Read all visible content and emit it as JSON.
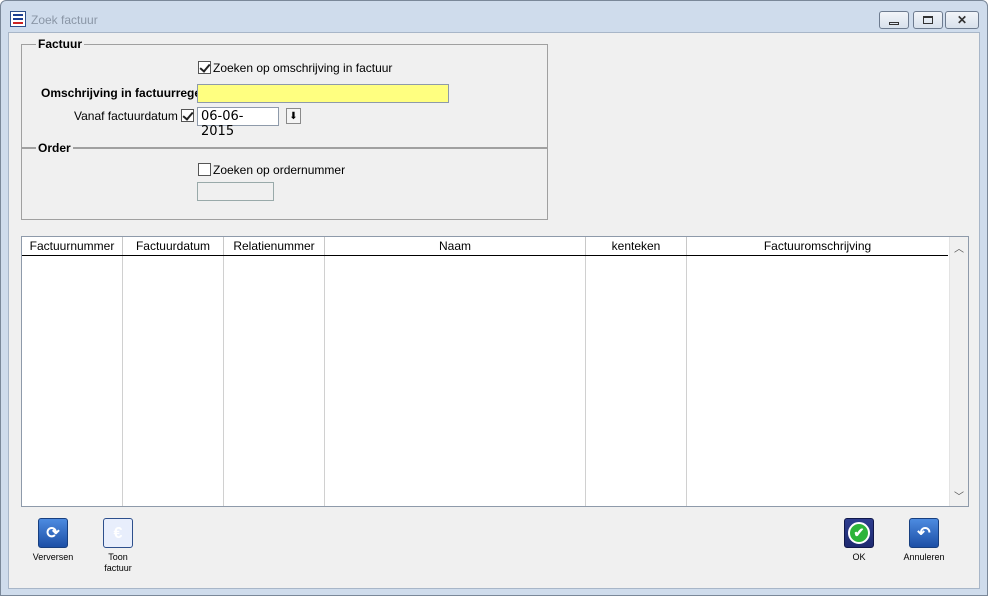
{
  "window": {
    "title": "Zoek factuur"
  },
  "factuur": {
    "legend": "Factuur",
    "search_desc_label": "Zoeken op omschrijving in factuur",
    "search_desc_checked": true,
    "omschrijving_label": "Omschrijving in factuurregel",
    "omschrijving_value": "",
    "vanaf_label": "Vanaf factuurdatum",
    "vanaf_checked": true,
    "vanaf_value": "06-06-2015"
  },
  "order": {
    "legend": "Order",
    "search_order_label": "Zoeken op ordernummer",
    "search_order_checked": false,
    "ordernummer_value": ""
  },
  "table": {
    "columns": [
      "Factuurnummer",
      "Factuurdatum",
      "Relatienummer",
      "Naam",
      "kenteken",
      "Factuuromschrijving"
    ],
    "rows": []
  },
  "toolbar": {
    "verversen": "Verversen",
    "toon_factuur_1": "Toon",
    "toon_factuur_2": "factuur",
    "ok": "OK",
    "annuleren": "Annuleren"
  },
  "icons": {
    "refresh": "refresh-icon",
    "invoice": "invoice-icon",
    "ok": "check-icon",
    "cancel": "undo-icon"
  }
}
